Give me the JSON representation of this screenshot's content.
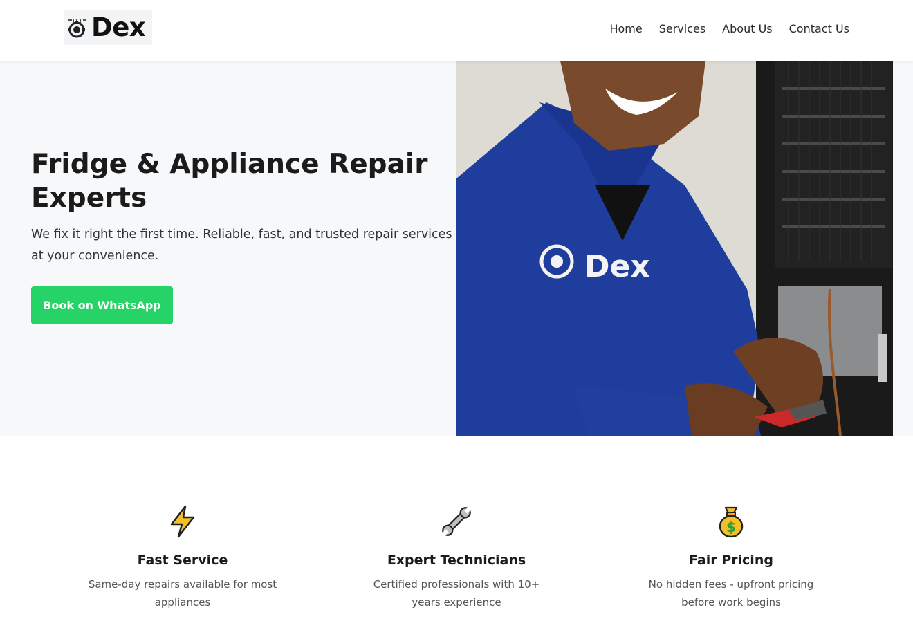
{
  "brand": {
    "name": "Dex",
    "logo_icon": "gear-tools-logo-icon"
  },
  "nav": {
    "items": [
      "Home",
      "Services",
      "About Us",
      "Contact Us"
    ]
  },
  "hero": {
    "title": "Fridge & Appliance Repair Experts",
    "subtitle": "We fix it right the first time. Reliable, fast, and trusted repair services at your convenience.",
    "cta_label": "Book on WhatsApp",
    "cta_color": "#25d366",
    "image_subject": "technician-repairing-fridge",
    "uniform_logo_text": "Dex"
  },
  "features": [
    {
      "icon": "lightning-icon",
      "title": "Fast Service",
      "text": "Same-day repairs available for most appliances"
    },
    {
      "icon": "wrench-icon",
      "title": "Expert Technicians",
      "text": "Certified professionals with 10+ years experience"
    },
    {
      "icon": "money-bag-icon",
      "title": "Fair Pricing",
      "text": "No hidden fees - upfront pricing before work begins"
    }
  ]
}
